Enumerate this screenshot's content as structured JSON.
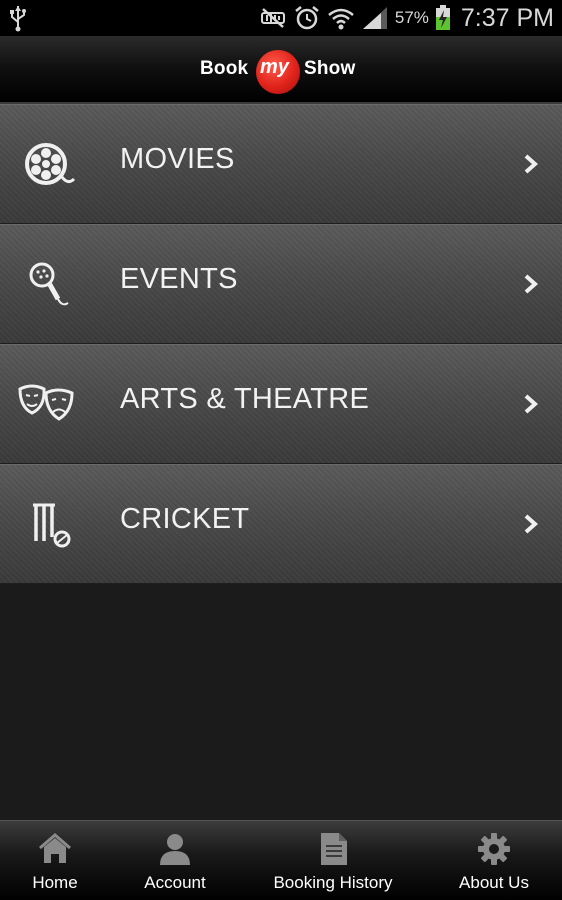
{
  "status_bar": {
    "battery": "57%",
    "time": "7:37 PM",
    "icons": [
      "usb-icon",
      "mute-icon",
      "alarm-icon",
      "wifi-icon",
      "signal-icon",
      "battery-icon"
    ]
  },
  "app": {
    "logo": {
      "word1": "Book",
      "word2": "my",
      "word3": "Show"
    },
    "brand_red": "#e0231a"
  },
  "menu": {
    "items": [
      {
        "label": "MOVIES",
        "icon": "film-reel-icon"
      },
      {
        "label": "EVENTS",
        "icon": "microphone-icon"
      },
      {
        "label": "ARTS & THEATRE",
        "icon": "theatre-masks-icon"
      },
      {
        "label": "CRICKET",
        "icon": "cricket-wickets-icon"
      }
    ]
  },
  "bottom_nav": {
    "tabs": [
      {
        "label": "Home",
        "icon": "home-icon"
      },
      {
        "label": "Account",
        "icon": "user-icon"
      },
      {
        "label": "Booking History",
        "icon": "document-icon"
      },
      {
        "label": "About Us",
        "icon": "gear-icon"
      }
    ]
  }
}
